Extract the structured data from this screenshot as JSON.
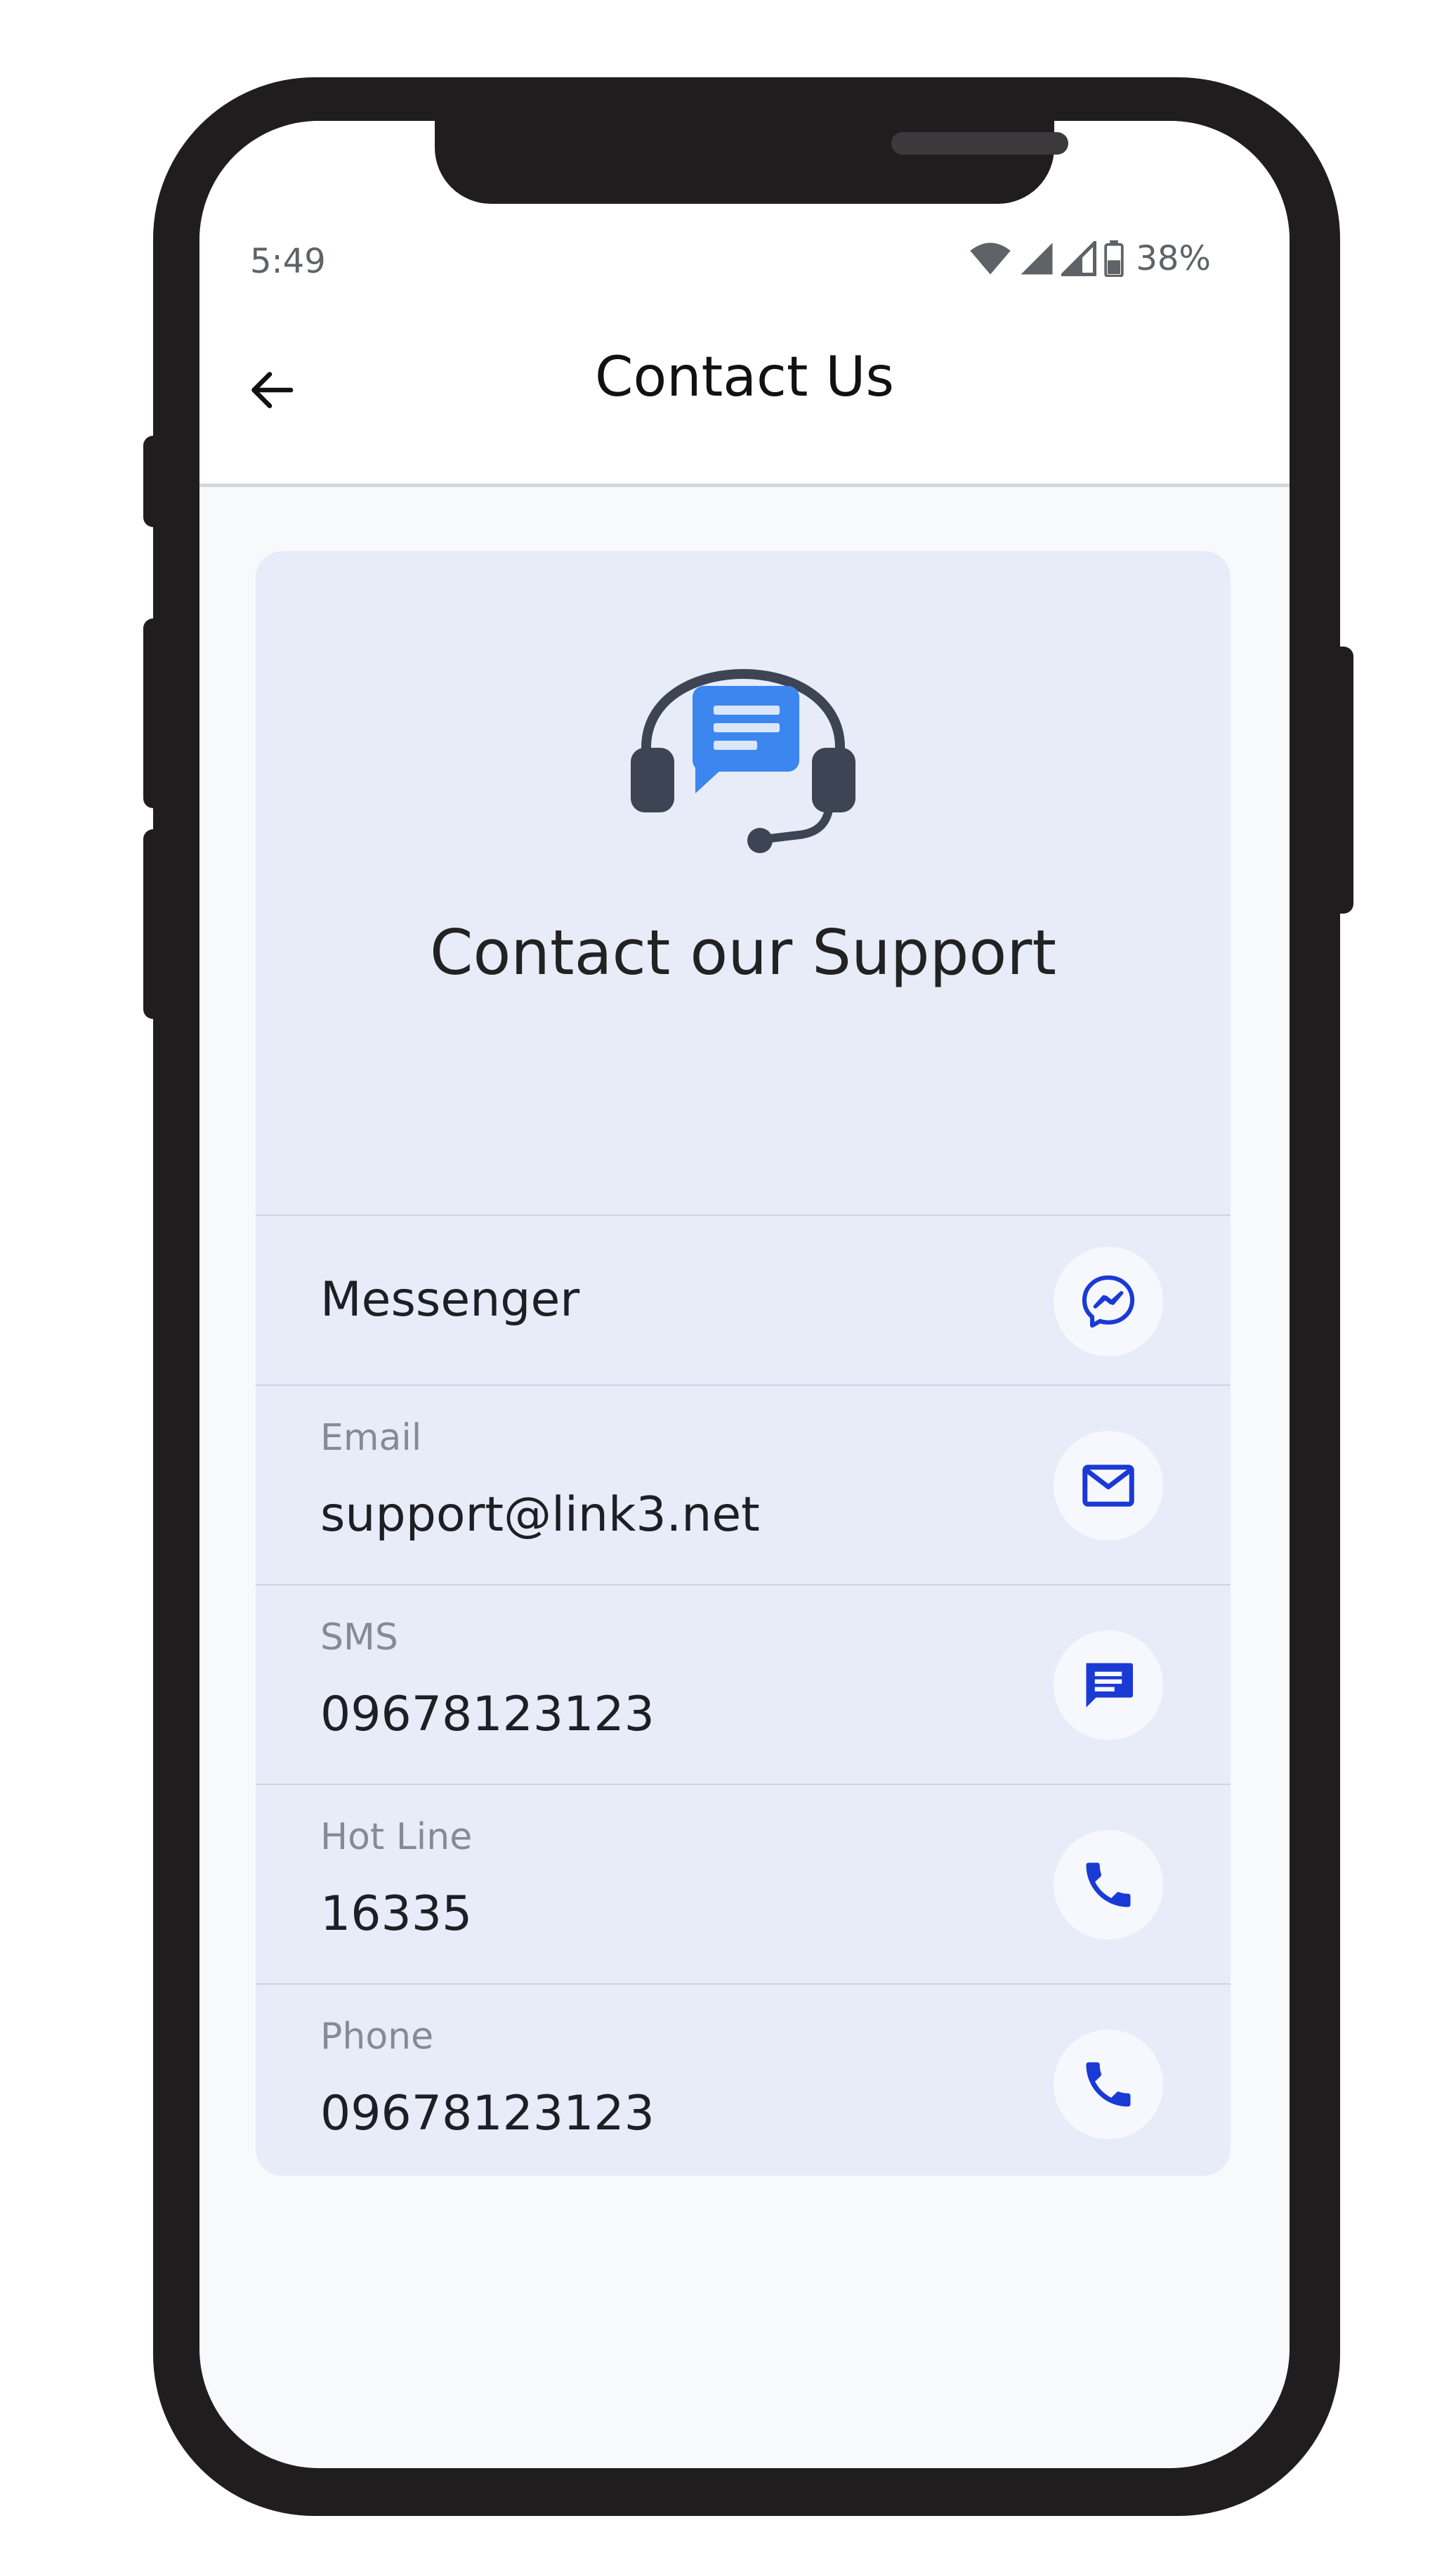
{
  "status_bar": {
    "time": "5:49",
    "battery": "38%",
    "icons": [
      "wifi-icon",
      "signal-icon",
      "signal-icon",
      "battery-icon"
    ]
  },
  "app_bar": {
    "title": "Contact Us",
    "back_icon": "arrow-left-icon"
  },
  "card": {
    "icon": "support-headset-icon",
    "title": "Contact our Support",
    "contacts": [
      {
        "label": "",
        "value": "Messenger",
        "icon": "messenger-icon"
      },
      {
        "label": "Email",
        "value": "support@link3.net",
        "icon": "email-icon"
      },
      {
        "label": "SMS",
        "value": "09678123123",
        "icon": "sms-icon"
      },
      {
        "label": "Hot Line",
        "value": "16335",
        "icon": "phone-icon"
      },
      {
        "label": "Phone",
        "value": "09678123123",
        "icon": "phone-icon"
      }
    ]
  },
  "colors": {
    "accent": "#1a3ad6",
    "card_background": "#e8ecf9",
    "screen_background": "#f8f9fb",
    "headset_dark": "#3d4453",
    "headset_bubble": "#3c86f0"
  }
}
